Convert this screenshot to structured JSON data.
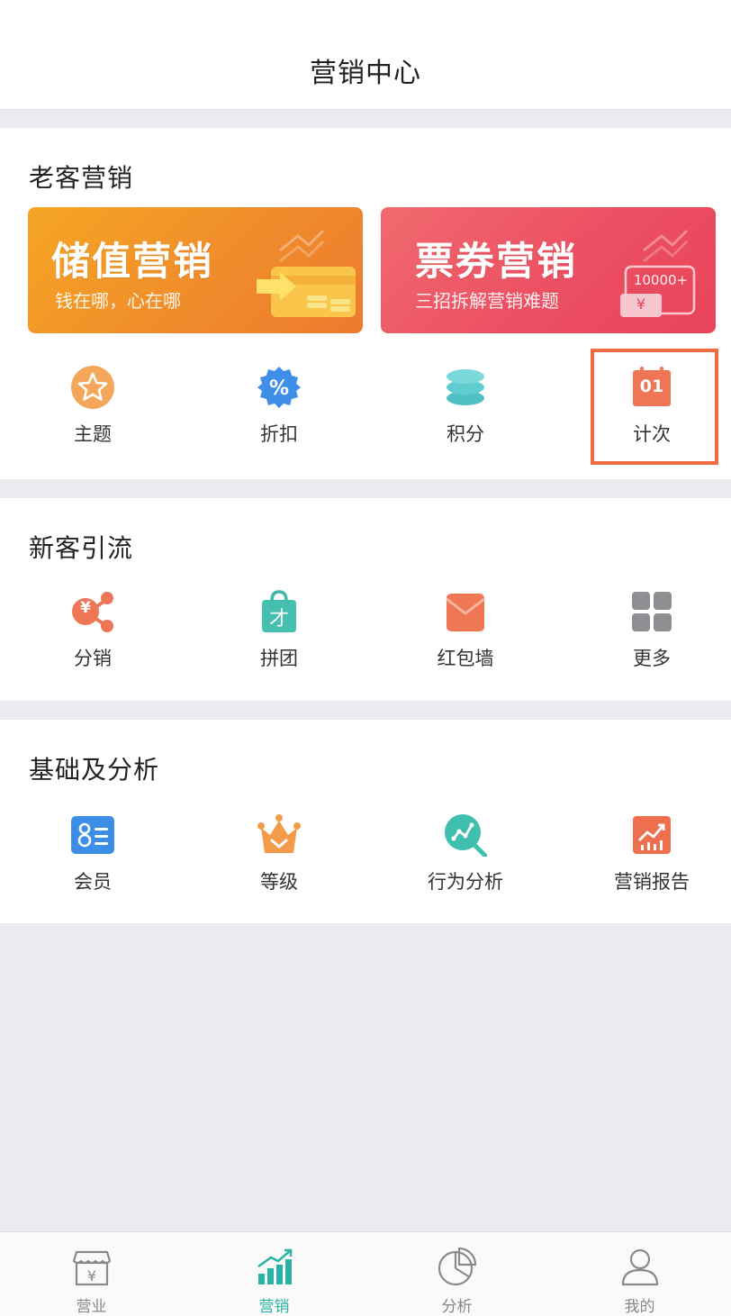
{
  "header": {
    "title": "营销中心"
  },
  "old_customer": {
    "title": "老客营销",
    "banners": [
      {
        "title": "储值营销",
        "subtitle": "钱在哪，心在哪"
      },
      {
        "title": "票券营销",
        "subtitle": "三招拆解营销难题",
        "badge": "10000+",
        "currency": "¥"
      }
    ],
    "items": [
      {
        "label": "主题",
        "icon": "star-icon"
      },
      {
        "label": "折扣",
        "icon": "percent-badge-icon"
      },
      {
        "label": "积分",
        "icon": "coin-stack-icon"
      },
      {
        "label": "计次",
        "icon": "calendar-icon",
        "icon_text": "01"
      }
    ]
  },
  "new_customer": {
    "title": "新客引流",
    "items": [
      {
        "label": "分销",
        "icon": "share-yen-icon",
        "icon_text": "¥"
      },
      {
        "label": "拼团",
        "icon": "shopping-bag-icon",
        "icon_text": "才"
      },
      {
        "label": "红包墙",
        "icon": "envelope-icon"
      },
      {
        "label": "更多",
        "icon": "grid-icon"
      }
    ]
  },
  "basics": {
    "title": "基础及分析",
    "items": [
      {
        "label": "会员",
        "icon": "member-card-icon"
      },
      {
        "label": "等级",
        "icon": "crown-icon"
      },
      {
        "label": "行为分析",
        "icon": "analysis-search-icon"
      },
      {
        "label": "营销报告",
        "icon": "report-chart-icon"
      }
    ]
  },
  "tabbar": {
    "tabs": [
      {
        "label": "营业",
        "icon": "shop-icon",
        "active": false
      },
      {
        "label": "营销",
        "icon": "growth-bars-icon",
        "active": true
      },
      {
        "label": "分析",
        "icon": "pie-chart-icon",
        "active": false
      },
      {
        "label": "我的",
        "icon": "user-icon",
        "active": false
      }
    ]
  },
  "colors": {
    "accent": "#2ab3a3",
    "highlight": "#f26c42",
    "banner_orange": "#f0902a",
    "banner_red": "#ea4a5c"
  }
}
